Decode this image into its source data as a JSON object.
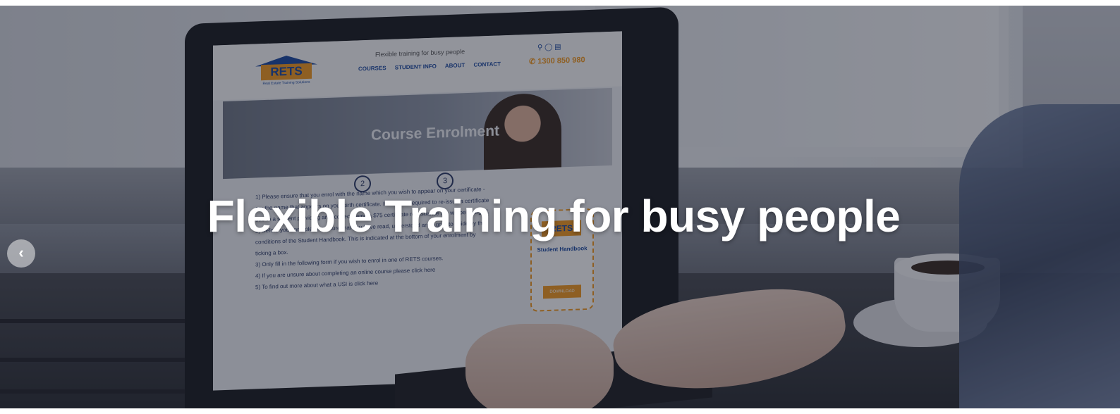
{
  "slider": {
    "title": "Flexible Training for busy people",
    "prev_icon": "chevron-left-icon"
  },
  "screen": {
    "logo_text": "RETS",
    "logo_sub": "Real Estate Training Solutions",
    "tagline": "Flexible training for busy people",
    "nav": [
      "COURSES",
      "STUDENT INFO",
      "ABOUT",
      "CONTACT"
    ],
    "phone": "1300 850 980",
    "banner_title": "Course Enrolment",
    "steps": [
      "2",
      "3"
    ],
    "body_lines": [
      "1) Please ensure that you enrol with the name which you wish to appear on your certificate -",
      "eg: the name that appears on your birth certificate. If RETS is required to re-issue a certificate",
      "due to a student providing an incorrect name a $75 certificate re-issuance fee will be charged.",
      "2) Before you enrol please ensure that you have read, understood and agree to abide by the",
      "conditions of the Student Handbook. This is indicated at the bottom of your enrolment by",
      "ticking a box.",
      "3) Only fill in the following form if you wish to enrol in one of RETS courses.",
      "4) If you are unsure about completing an online course please click here",
      "5) To find out more about what a USI is click here"
    ],
    "handbook_logo": "RETS",
    "handbook_title": "Student Handbook",
    "handbook_button": "DOWNLOAD"
  }
}
